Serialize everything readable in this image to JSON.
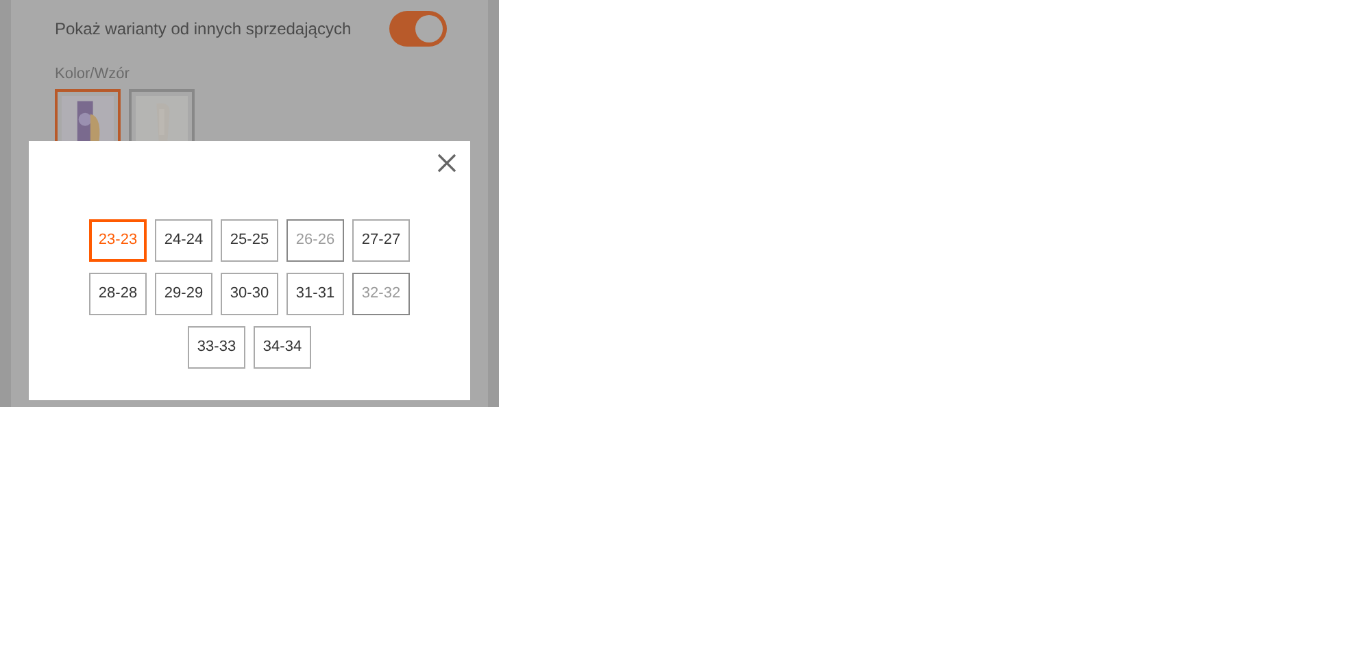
{
  "background_panel": {
    "toggle": {
      "label": "Pokaż warianty od innych sprzedających",
      "on": true
    },
    "color_pattern": {
      "label": "Kolor/Wzór",
      "swatches": [
        {
          "kind": "picture",
          "selected": true
        },
        {
          "kind": "picture",
          "selected": false
        }
      ]
    }
  },
  "size_dialog": {
    "sizes": [
      {
        "label": "23-23",
        "selected": true,
        "disabled": false
      },
      {
        "label": "24-24",
        "selected": false,
        "disabled": false
      },
      {
        "label": "25-25",
        "selected": false,
        "disabled": false
      },
      {
        "label": "26-26",
        "selected": false,
        "disabled": true
      },
      {
        "label": "27-27",
        "selected": false,
        "disabled": false
      },
      {
        "label": "28-28",
        "selected": false,
        "disabled": false
      },
      {
        "label": "29-29",
        "selected": false,
        "disabled": false
      },
      {
        "label": "30-30",
        "selected": false,
        "disabled": false
      },
      {
        "label": "31-31",
        "selected": false,
        "disabled": false
      },
      {
        "label": "32-32",
        "selected": false,
        "disabled": true
      },
      {
        "label": "33-33",
        "selected": false,
        "disabled": false
      },
      {
        "label": "34-34",
        "selected": false,
        "disabled": false
      }
    ]
  }
}
